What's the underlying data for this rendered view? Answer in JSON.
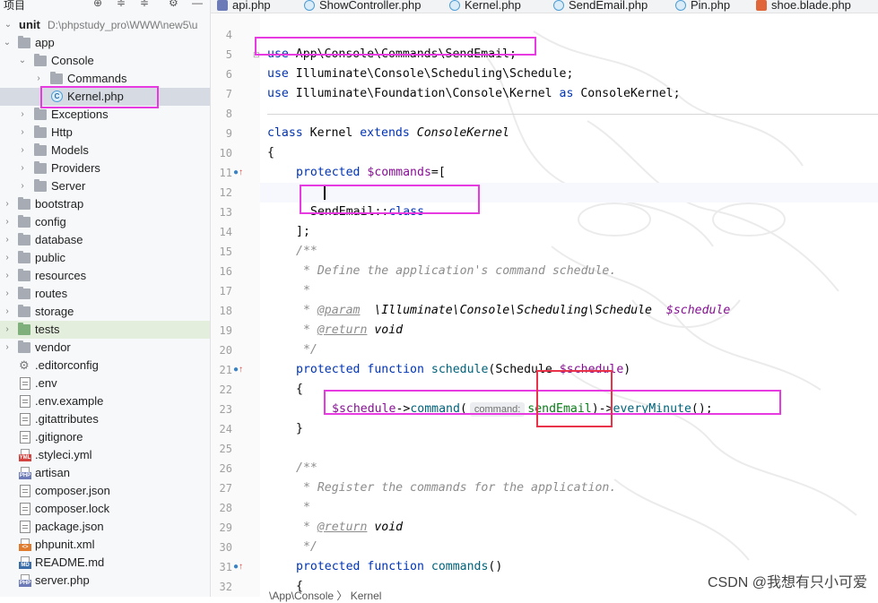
{
  "project_panel": {
    "title": "项目",
    "root": {
      "name": "unit",
      "path": "D:\\phpstudy_pro\\WWW\\new5\\u"
    },
    "items": [
      {
        "label": "app"
      },
      {
        "label": "Console"
      },
      {
        "label": "Commands"
      },
      {
        "label": "Kernel.php"
      },
      {
        "label": "Exceptions"
      },
      {
        "label": "Http"
      },
      {
        "label": "Models"
      },
      {
        "label": "Providers"
      },
      {
        "label": "Server"
      },
      {
        "label": "bootstrap"
      },
      {
        "label": "config"
      },
      {
        "label": "database"
      },
      {
        "label": "public"
      },
      {
        "label": "resources"
      },
      {
        "label": "routes"
      },
      {
        "label": "storage"
      },
      {
        "label": "tests"
      },
      {
        "label": "vendor"
      },
      {
        "label": ".editorconfig"
      },
      {
        "label": ".env"
      },
      {
        "label": ".env.example"
      },
      {
        "label": ".gitattributes"
      },
      {
        "label": ".gitignore"
      },
      {
        "label": ".styleci.yml"
      },
      {
        "label": "artisan"
      },
      {
        "label": "composer.json"
      },
      {
        "label": "composer.lock"
      },
      {
        "label": "package.json"
      },
      {
        "label": "phpunit.xml"
      },
      {
        "label": "README.md"
      },
      {
        "label": "server.php"
      }
    ]
  },
  "tabs": [
    {
      "label": "api.php"
    },
    {
      "label": "ShowController.php"
    },
    {
      "label": "Kernel.php",
      "active": true
    },
    {
      "label": "SendEmail.php"
    },
    {
      "label": "Pin.php"
    },
    {
      "label": "shoe.blade.php"
    }
  ],
  "editor": {
    "line_numbers": [
      "4",
      "5",
      "6",
      "7",
      "8",
      "9",
      "10",
      "11",
      "12",
      "13",
      "14",
      "15",
      "16",
      "17",
      "18",
      "19",
      "20",
      "21",
      "22",
      "23",
      "24",
      "25",
      "26",
      "27",
      "28",
      "29",
      "30",
      "31",
      "32"
    ],
    "lines": {
      "l5_use": "use",
      "l5_path": " App\\Console\\Commands\\SendEmail;",
      "l6_use": "use",
      "l6_path": " Illuminate\\Console\\Scheduling\\Schedule;",
      "l7_use": "use",
      "l7_path": " Illuminate\\Foundation\\Console\\Kernel ",
      "l7_as": "as",
      "l7_alias": " ConsoleKernel;",
      "l9_class": "class",
      "l9_name": " Kernel ",
      "l9_extends": "extends",
      "l9_parent": " ConsoleKernel",
      "l10": "{",
      "l11_protected": "protected",
      "l11_var": "$commands",
      "l11_rest": "=[",
      "l13_class": "SendEmail::",
      "l13_kw": "class",
      "l14": "];",
      "l15": "/**",
      "l16": " * Define the application's command schedule.",
      "l17": " *",
      "l18_star": " * ",
      "l18_tag": "@param",
      "l18_type": "  \\Illuminate\\Console\\Scheduling\\Schedule  ",
      "l18_var": "$schedule",
      "l19_star": " * ",
      "l19_tag": "@return",
      "l19_type": " void",
      "l20": " */",
      "l21_protected": "protected",
      "l21_function": " function ",
      "l21_name": "schedule",
      "l21_open": "(Schedule ",
      "l21_var": "$schedule",
      "l21_close": ")",
      "l22": "{",
      "l23_var": "$schedule",
      "l23_arrow": "->",
      "l23_fn": "command",
      "l23_open": "(",
      "l23_hint": "command:",
      "l23_arg": "sendEmail",
      "l23_close": ")->",
      "l23_fn2": "everyMinute",
      "l23_end": "();",
      "l24": "}",
      "l26": "/**",
      "l27": " * Register the commands for the application.",
      "l28": " *",
      "l29_star": " * ",
      "l29_tag": "@return",
      "l29_type": " void",
      "l30": " */",
      "l31_protected": "protected",
      "l31_function": " function ",
      "l31_name": "commands",
      "l31_rest": "()",
      "l32": "{"
    }
  },
  "breadcrumb": "\\App\\Console  〉 Kernel",
  "watermark": "CSDN @我想有只小可爱",
  "colors": {
    "annotation_magenta": "#e83ae1",
    "annotation_red": "#e8334a",
    "selection": "#d5dae3"
  }
}
